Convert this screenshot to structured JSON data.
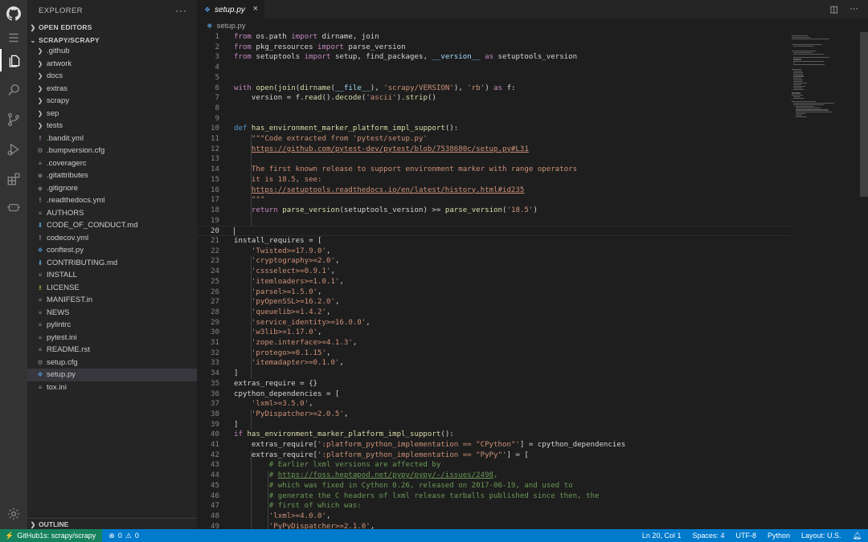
{
  "sidebar": {
    "title": "EXPLORER",
    "more": "···",
    "open_editors": "OPEN EDITORS",
    "repo": "SCRAPY/SCRAPY",
    "outline": "OUTLINE",
    "items": [
      {
        "label": ".github",
        "type": "folder",
        "icon": "chevron-right-icon"
      },
      {
        "label": "artwork",
        "type": "folder",
        "icon": "chevron-right-icon"
      },
      {
        "label": "docs",
        "type": "folder",
        "icon": "chevron-right-icon"
      },
      {
        "label": "extras",
        "type": "folder",
        "icon": "chevron-right-icon"
      },
      {
        "label": "scrapy",
        "type": "folder",
        "icon": "chevron-right-icon"
      },
      {
        "label": "sep",
        "type": "folder",
        "icon": "chevron-right-icon"
      },
      {
        "label": "tests",
        "type": "folder",
        "icon": "chevron-right-icon"
      },
      {
        "label": ".bandit.yml",
        "type": "yml",
        "icon": "yaml-file-icon"
      },
      {
        "label": ".bumpversion.cfg",
        "type": "gear",
        "icon": "config-file-icon"
      },
      {
        "label": ".coveragerc",
        "type": "lines",
        "icon": "text-file-icon"
      },
      {
        "label": ".gitattributes",
        "type": "dia",
        "icon": "git-file-icon"
      },
      {
        "label": ".gitignore",
        "type": "dia",
        "icon": "git-file-icon"
      },
      {
        "label": ".readthedocs.yml",
        "type": "yml",
        "icon": "yaml-file-icon"
      },
      {
        "label": "AUTHORS",
        "type": "lines",
        "icon": "text-file-icon"
      },
      {
        "label": "CODE_OF_CONDUCT.md",
        "type": "md",
        "icon": "markdown-file-icon"
      },
      {
        "label": "codecov.yml",
        "type": "yml",
        "icon": "yaml-file-icon"
      },
      {
        "label": "conftest.py",
        "type": "py",
        "icon": "python-file-icon"
      },
      {
        "label": "CONTRIBUTING.md",
        "type": "md",
        "icon": "markdown-file-icon"
      },
      {
        "label": "INSTALL",
        "type": "lines",
        "icon": "text-file-icon"
      },
      {
        "label": "LICENSE",
        "type": "lic",
        "icon": "license-file-icon"
      },
      {
        "label": "MANIFEST.in",
        "type": "lines",
        "icon": "text-file-icon"
      },
      {
        "label": "NEWS",
        "type": "lines",
        "icon": "text-file-icon"
      },
      {
        "label": "pylintrc",
        "type": "lines",
        "icon": "text-file-icon"
      },
      {
        "label": "pytest.ini",
        "type": "lines",
        "icon": "text-file-icon"
      },
      {
        "label": "README.rst",
        "type": "lines",
        "icon": "text-file-icon"
      },
      {
        "label": "setup.cfg",
        "type": "gear",
        "icon": "config-file-icon"
      },
      {
        "label": "setup.py",
        "type": "py",
        "icon": "python-file-icon",
        "selected": true
      },
      {
        "label": "tox.ini",
        "type": "lines",
        "icon": "text-file-icon"
      }
    ]
  },
  "tab": {
    "label": "setup.py",
    "close": "×"
  },
  "breadcrumb": {
    "file": "setup.py"
  },
  "editor": {
    "current_line": 20,
    "lines": [
      [
        [
          "k",
          "from"
        ],
        [
          "t",
          " os.path "
        ],
        [
          "k",
          "import"
        ],
        [
          "t",
          " dirname, join"
        ]
      ],
      [
        [
          "k",
          "from"
        ],
        [
          "t",
          " pkg_resources "
        ],
        [
          "k",
          "import"
        ],
        [
          "t",
          " parse_version"
        ]
      ],
      [
        [
          "k",
          "from"
        ],
        [
          "t",
          " setuptools "
        ],
        [
          "k",
          "import"
        ],
        [
          "t",
          " setup, find_packages, "
        ],
        [
          "v",
          "__version__"
        ],
        [
          "t",
          " "
        ],
        [
          "k",
          "as"
        ],
        [
          "t",
          " setuptools_version"
        ]
      ],
      [],
      [],
      [
        [
          "k",
          "with"
        ],
        [
          "t",
          " "
        ],
        [
          "f",
          "open"
        ],
        [
          "t",
          "("
        ],
        [
          "f",
          "join"
        ],
        [
          "t",
          "("
        ],
        [
          "f",
          "dirname"
        ],
        [
          "t",
          "("
        ],
        [
          "v",
          "__file__"
        ],
        [
          "t",
          "), "
        ],
        [
          "s",
          "'scrapy/VERSION'"
        ],
        [
          "t",
          "), "
        ],
        [
          "s",
          "'rb'"
        ],
        [
          "t",
          ") "
        ],
        [
          "k",
          "as"
        ],
        [
          "t",
          " f:"
        ]
      ],
      [
        [
          "t",
          "    version = f."
        ],
        [
          "f",
          "read"
        ],
        [
          "t",
          "()."
        ],
        [
          "f",
          "decode"
        ],
        [
          "t",
          "("
        ],
        [
          "s",
          "'ascii'"
        ],
        [
          "t",
          ")."
        ],
        [
          "f",
          "strip"
        ],
        [
          "t",
          "()"
        ]
      ],
      [],
      [],
      [
        [
          "b",
          "def"
        ],
        [
          "t",
          " "
        ],
        [
          "f",
          "has_environment_marker_platform_impl_support"
        ],
        [
          "t",
          "():"
        ]
      ],
      [
        [
          "s",
          "    \"\"\"Code extracted from 'pytest/setup.py'"
        ]
      ],
      [
        [
          "s",
          "    "
        ],
        [
          "su",
          "https://github.com/pytest-dev/pytest/blob/7538680c/setup.py#L31"
        ]
      ],
      [],
      [
        [
          "s",
          "    The first known release to support environment marker with range operators"
        ]
      ],
      [
        [
          "s",
          "    it is 18.5, see:"
        ]
      ],
      [
        [
          "s",
          "    "
        ],
        [
          "su",
          "https://setuptools.readthedocs.io/en/latest/history.html#id235"
        ]
      ],
      [
        [
          "s",
          "    \"\"\""
        ]
      ],
      [
        [
          "t",
          "    "
        ],
        [
          "k",
          "return"
        ],
        [
          "t",
          " "
        ],
        [
          "f",
          "parse_version"
        ],
        [
          "t",
          "(setuptools_version) >= "
        ],
        [
          "f",
          "parse_version"
        ],
        [
          "t",
          "("
        ],
        [
          "s",
          "'18.5'"
        ],
        [
          "t",
          ")"
        ]
      ],
      [],
      [],
      [
        [
          "t",
          "install_requires = ["
        ]
      ],
      [
        [
          "t",
          "    "
        ],
        [
          "s",
          "'Twisted>=17.9.0'"
        ],
        [
          "t",
          ","
        ]
      ],
      [
        [
          "t",
          "    "
        ],
        [
          "s",
          "'cryptography>=2.0'"
        ],
        [
          "t",
          ","
        ]
      ],
      [
        [
          "t",
          "    "
        ],
        [
          "s",
          "'cssselect>=0.9.1'"
        ],
        [
          "t",
          ","
        ]
      ],
      [
        [
          "t",
          "    "
        ],
        [
          "s",
          "'itemloaders>=1.0.1'"
        ],
        [
          "t",
          ","
        ]
      ],
      [
        [
          "t",
          "    "
        ],
        [
          "s",
          "'parsel>=1.5.0'"
        ],
        [
          "t",
          ","
        ]
      ],
      [
        [
          "t",
          "    "
        ],
        [
          "s",
          "'pyOpenSSL>=16.2.0'"
        ],
        [
          "t",
          ","
        ]
      ],
      [
        [
          "t",
          "    "
        ],
        [
          "s",
          "'queuelib>=1.4.2'"
        ],
        [
          "t",
          ","
        ]
      ],
      [
        [
          "t",
          "    "
        ],
        [
          "s",
          "'service_identity>=16.0.0'"
        ],
        [
          "t",
          ","
        ]
      ],
      [
        [
          "t",
          "    "
        ],
        [
          "s",
          "'w3lib>=1.17.0'"
        ],
        [
          "t",
          ","
        ]
      ],
      [
        [
          "t",
          "    "
        ],
        [
          "s",
          "'zope.interface>=4.1.3'"
        ],
        [
          "t",
          ","
        ]
      ],
      [
        [
          "t",
          "    "
        ],
        [
          "s",
          "'protego>=0.1.15'"
        ],
        [
          "t",
          ","
        ]
      ],
      [
        [
          "t",
          "    "
        ],
        [
          "s",
          "'itemadapter>=0.1.0'"
        ],
        [
          "t",
          ","
        ]
      ],
      [
        [
          "t",
          "]"
        ]
      ],
      [
        [
          "t",
          "extras_require = {}"
        ]
      ],
      [
        [
          "t",
          "cpython_dependencies = ["
        ]
      ],
      [
        [
          "t",
          "    "
        ],
        [
          "s",
          "'lxml>=3.5.0'"
        ],
        [
          "t",
          ","
        ]
      ],
      [
        [
          "t",
          "    "
        ],
        [
          "s",
          "'PyDispatcher>=2.0.5'"
        ],
        [
          "t",
          ","
        ]
      ],
      [
        [
          "t",
          "]"
        ]
      ],
      [
        [
          "k",
          "if"
        ],
        [
          "t",
          " "
        ],
        [
          "f",
          "has_environment_marker_platform_impl_support"
        ],
        [
          "t",
          "():"
        ]
      ],
      [
        [
          "t",
          "    extras_require["
        ],
        [
          "s",
          "':platform_python_implementation == \"CPython\"'"
        ],
        [
          "t",
          "] = cpython_dependencies"
        ]
      ],
      [
        [
          "t",
          "    extras_require["
        ],
        [
          "s",
          "':platform_python_implementation == \"PyPy\"'"
        ],
        [
          "t",
          "] = ["
        ]
      ],
      [
        [
          "c",
          "        # Earlier lxml versions are affected by"
        ]
      ],
      [
        [
          "c",
          "        # "
        ],
        [
          "cu",
          "https://foss.heptapod.net/pypy/pypy/-/issues/2498"
        ],
        [
          "c",
          ","
        ]
      ],
      [
        [
          "c",
          "        # which was fixed in Cython 0.26, released on 2017-06-19, and used to"
        ]
      ],
      [
        [
          "c",
          "        # generate the C headers of lxml release tarballs published since then, the"
        ]
      ],
      [
        [
          "c",
          "        # first of which was:"
        ]
      ],
      [
        [
          "t",
          "        "
        ],
        [
          "s",
          "'lxml>=4.0.0'"
        ],
        [
          "t",
          ","
        ]
      ],
      [
        [
          "t",
          "        "
        ],
        [
          "s",
          "'PyPyDispatcher>=2.1.0'"
        ],
        [
          "t",
          ","
        ]
      ]
    ]
  },
  "status": {
    "remote": "GitHub1s: scrapy/scrapy",
    "errors": "0",
    "warnings": "0",
    "position": "Ln 20, Col 1",
    "spaces": "Spaces: 4",
    "encoding": "UTF-8",
    "language": "Python",
    "layout": "Layout: U.S."
  }
}
